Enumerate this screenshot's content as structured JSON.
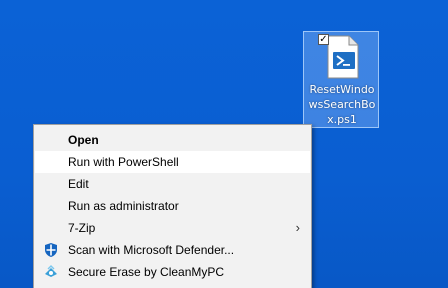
{
  "desktop": {
    "icon": {
      "label": "ResetWindowsSearchBox.ps1",
      "icon_name": "powershell-script-file-icon",
      "checked": true,
      "check_glyph": "✓"
    }
  },
  "context_menu": {
    "items": [
      {
        "label": "Open",
        "bold": true
      },
      {
        "label": "Run with PowerShell",
        "highlighted": true
      },
      {
        "label": "Edit"
      },
      {
        "label": "Run as administrator"
      },
      {
        "label": "7-Zip",
        "submenu_glyph": "›"
      },
      {
        "label": "Scan with Microsoft Defender...",
        "icon_name": "defender-shield-icon"
      },
      {
        "label": "Secure Erase by CleanMyPC",
        "icon_name": "cleanmypc-icon"
      }
    ]
  },
  "colors": {
    "desktop_blue": "#0a5ed1",
    "menu_bg": "#f2f2f2",
    "menu_hover": "#ffffff",
    "defender_blue": "#1565c0",
    "powershell_blue": "#1e6fc4"
  }
}
